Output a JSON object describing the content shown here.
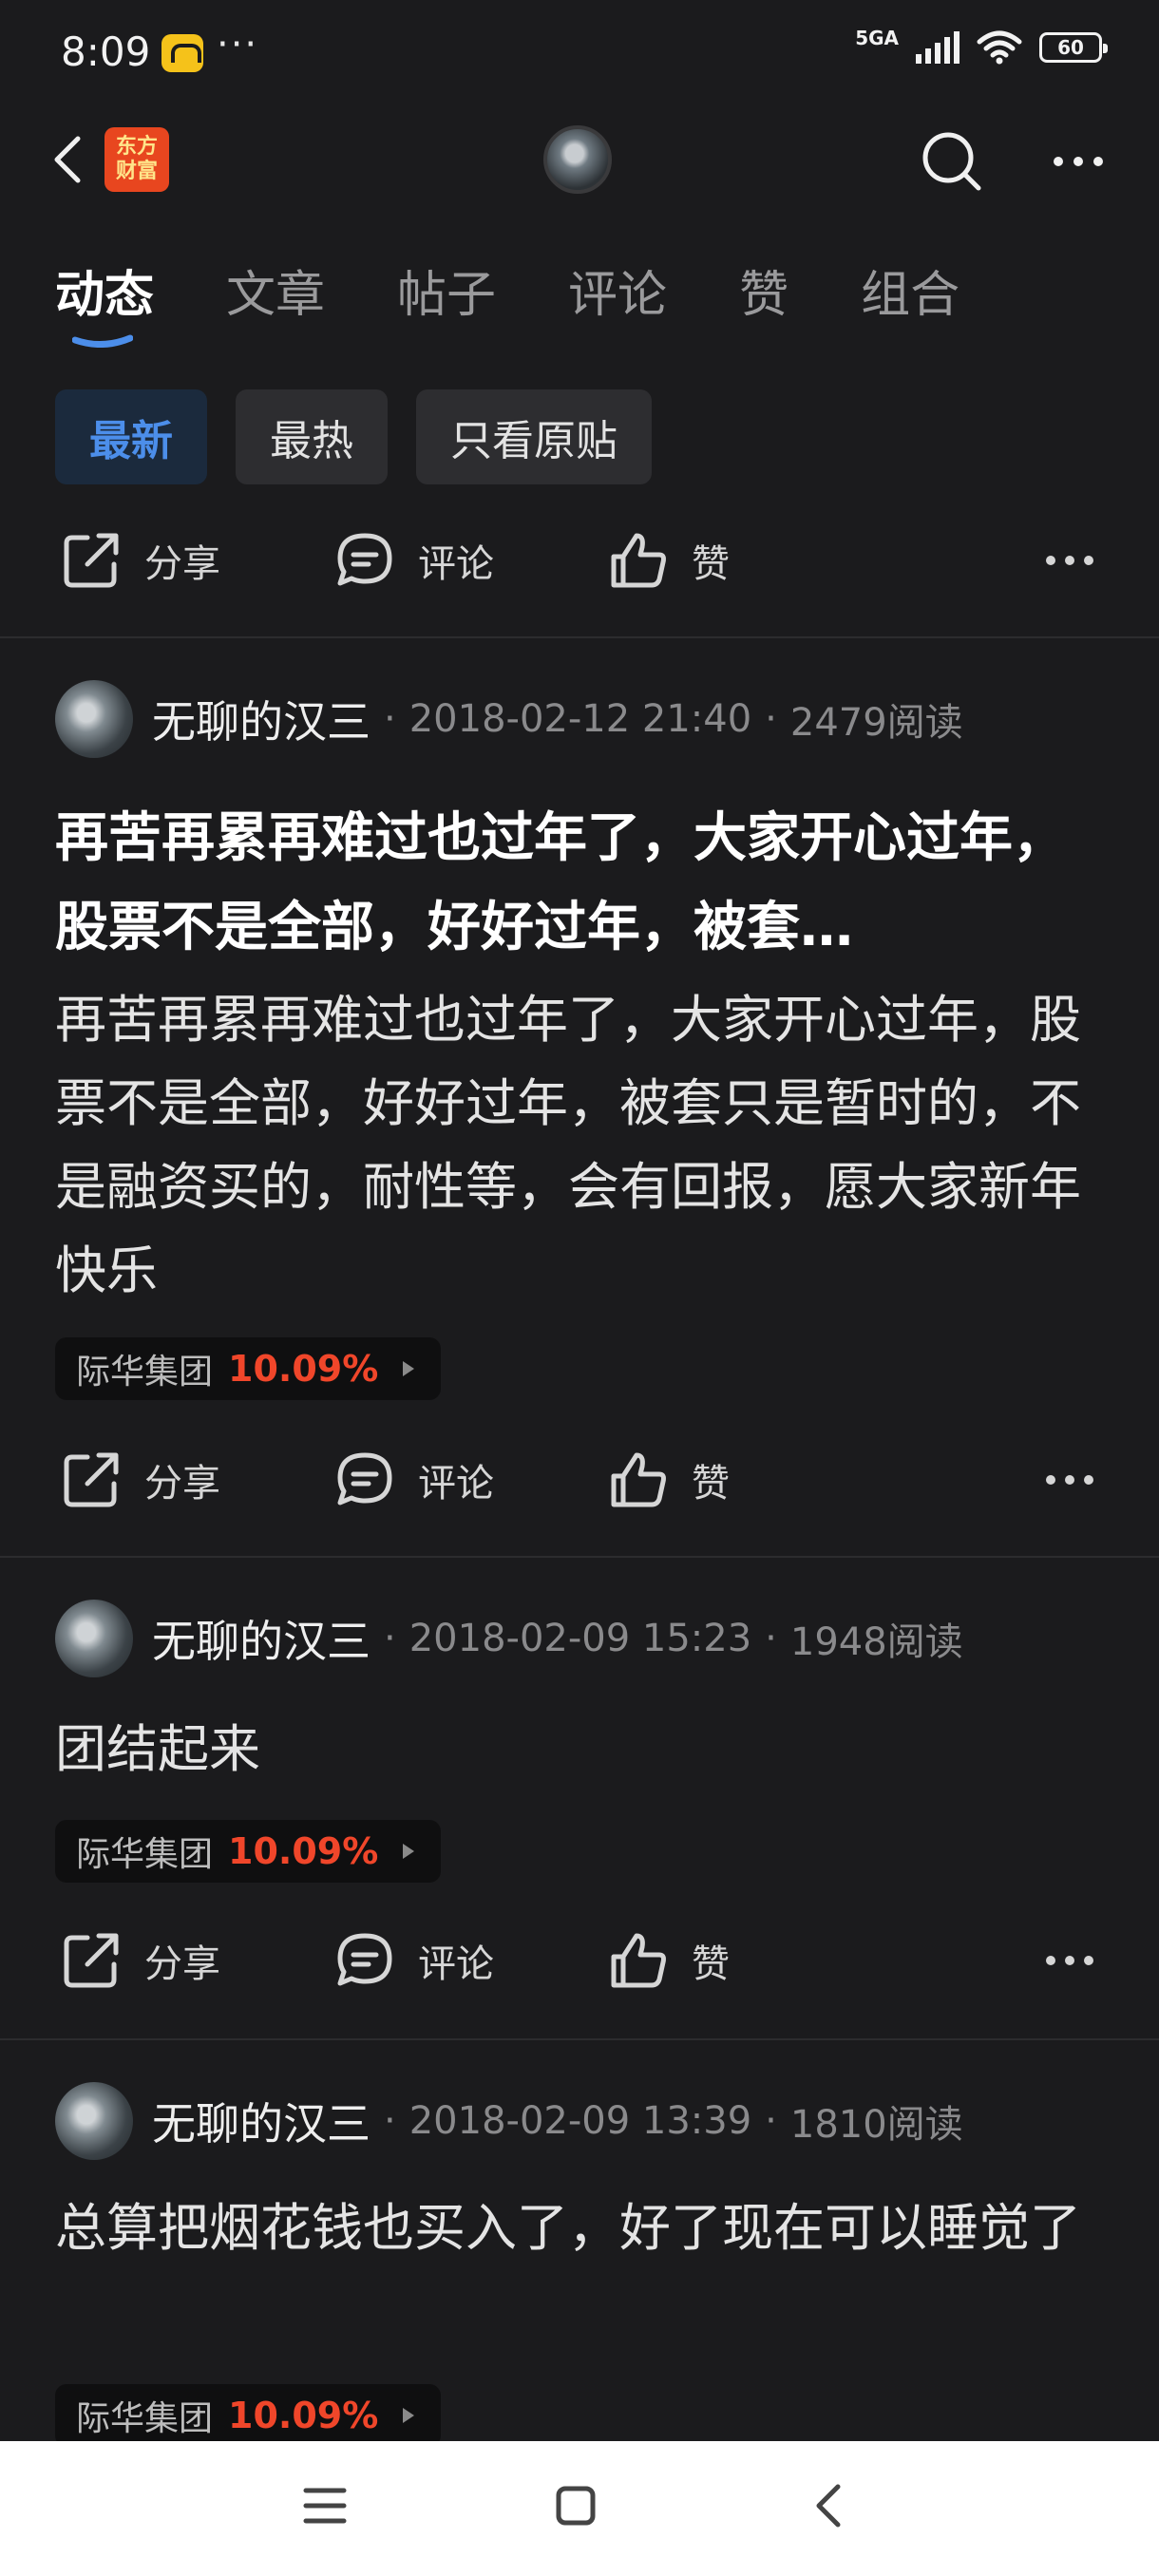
{
  "status_bar": {
    "time": "8:09",
    "more": "···",
    "network": "5GA",
    "battery": "60"
  },
  "header": {
    "logo_line1": "东方",
    "logo_line2": "财富"
  },
  "tabs": [
    {
      "label": "动态",
      "active": true
    },
    {
      "label": "文章",
      "active": false
    },
    {
      "label": "帖子",
      "active": false
    },
    {
      "label": "评论",
      "active": false
    },
    {
      "label": "赞",
      "active": false
    },
    {
      "label": "组合",
      "active": false
    }
  ],
  "filters": [
    {
      "label": "最新",
      "active": true
    },
    {
      "label": "最热",
      "active": false
    },
    {
      "label": "只看原贴",
      "active": false
    }
  ],
  "actions": {
    "share": "分享",
    "comment": "评论",
    "like": "赞"
  },
  "posts": [
    {
      "author": "无聊的汉三",
      "date": "2018-02-12 21:40",
      "reads": "2479阅读",
      "title": "再苦再累再难过也过年了，大家开心过年，股票不是全部，好好过年，被套…",
      "body": "再苦再累再难过也过年了，大家开心过年，股票不是全部，好好过年，被套只是暂时的，不是融资买的，耐性等，会有回报，愿大家新年快乐",
      "stock": {
        "name": "际华集团",
        "change": "10.09%"
      }
    },
    {
      "author": "无聊的汉三",
      "date": "2018-02-09 15:23",
      "reads": "1948阅读",
      "body": "团结起来",
      "stock": {
        "name": "际华集团",
        "change": "10.09%"
      }
    },
    {
      "author": "无聊的汉三",
      "date": "2018-02-09 13:39",
      "reads": "1810阅读",
      "body": "总算把烟花钱也买入了，好了现在可以睡觉了",
      "stock": {
        "name": "际华集团",
        "change": "10.09%"
      }
    }
  ],
  "colors": {
    "background": "#1b1b1d",
    "accent": "#4c8eea",
    "stock_up": "#f0462a",
    "logo": "#e8461f"
  }
}
